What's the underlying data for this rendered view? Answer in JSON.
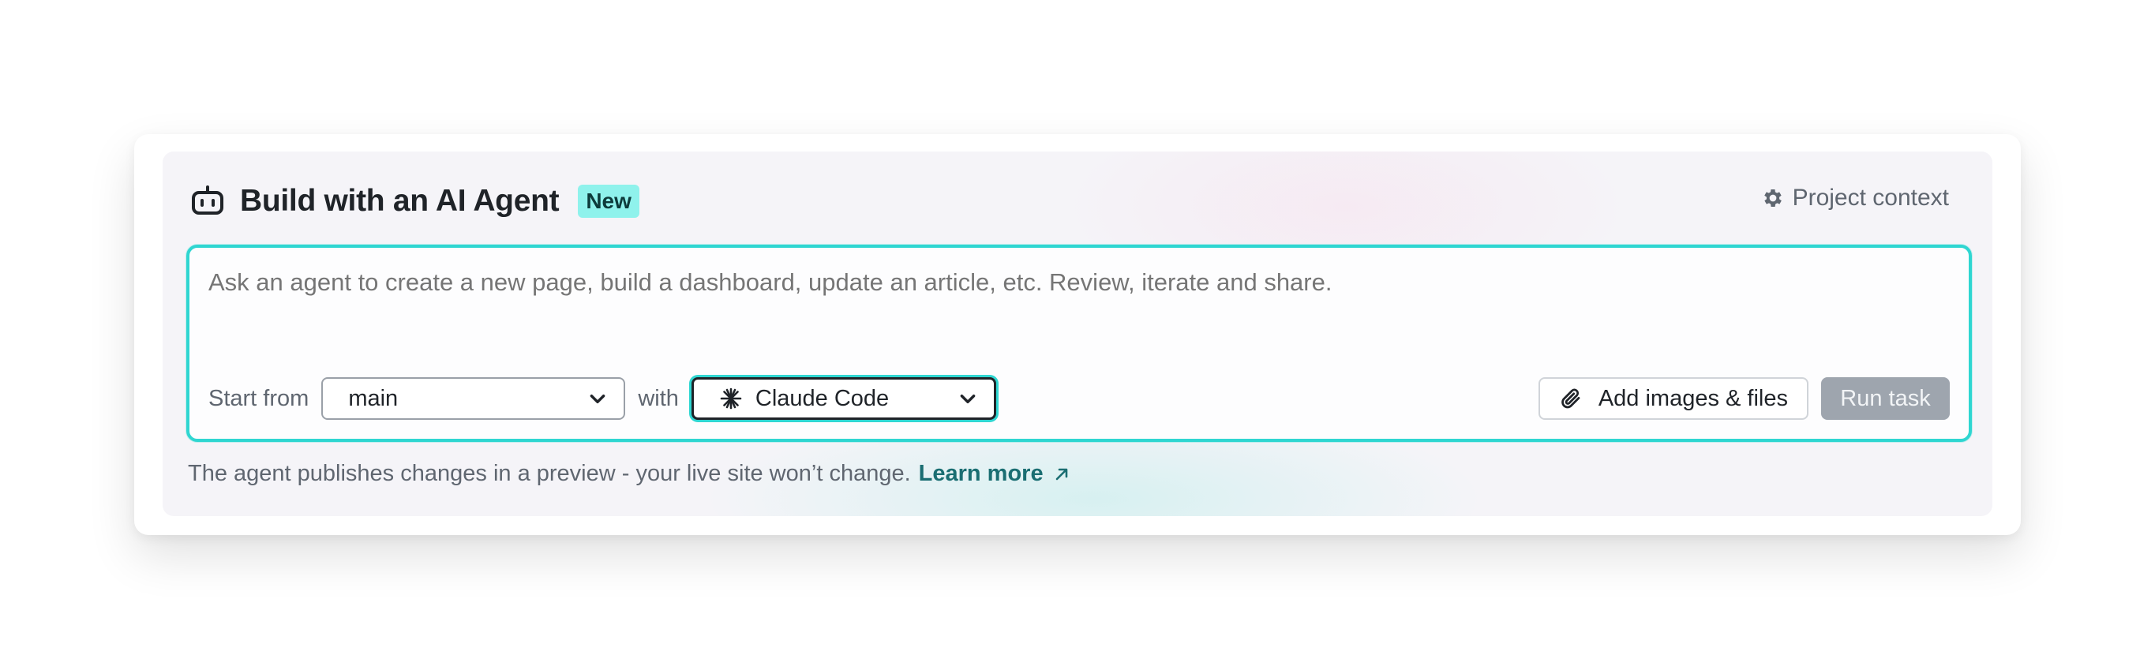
{
  "header": {
    "title": "Build with an AI Agent",
    "badge": "New",
    "project_context_label": "Project context",
    "icons": {
      "title": "robot-icon",
      "project_context": "gear-icon"
    }
  },
  "composer": {
    "prompt_placeholder": "Ask an agent to create a new page, build a dashboard, update an article, etc. Review, iterate and share.",
    "prompt_value": "",
    "start_from_label": "Start from",
    "branch_value": "main",
    "with_label": "with",
    "agent_value": "Claude Code",
    "agent_icon": "claude-asterisk-icon",
    "add_files_label": "Add images & files",
    "run_label": "Run task"
  },
  "footer": {
    "note": "The agent publishes changes in a preview - your live site won’t change.",
    "learn_more_label": "Learn more"
  },
  "colors": {
    "accent_border": "#2fd6d1",
    "badge_bg": "#8ff2ec",
    "link": "#1a6e72",
    "run_disabled_bg": "#9ea5ae"
  }
}
